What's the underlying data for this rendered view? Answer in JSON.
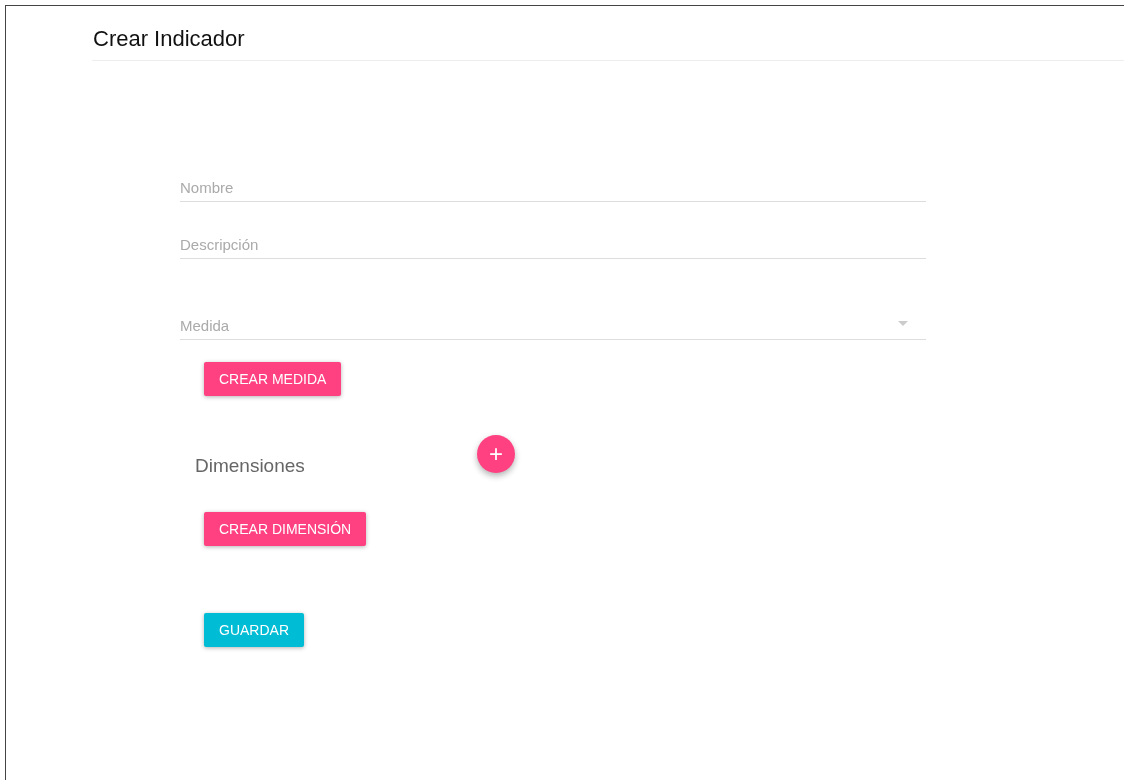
{
  "title": "Crear Indicador",
  "fields": [
    {
      "kind": "text",
      "placeholder": "Nombre"
    },
    {
      "kind": "text",
      "placeholder": "Descripción"
    },
    {
      "kind": "select",
      "placeholder": "Medida"
    }
  ],
  "measure_button": "CREAR MEDIDA",
  "dimensions": {
    "heading": "Dimensiones",
    "add_button": "+",
    "create_button": "CREAR DIMENSIÓN"
  },
  "save_button": "GUARDAR"
}
